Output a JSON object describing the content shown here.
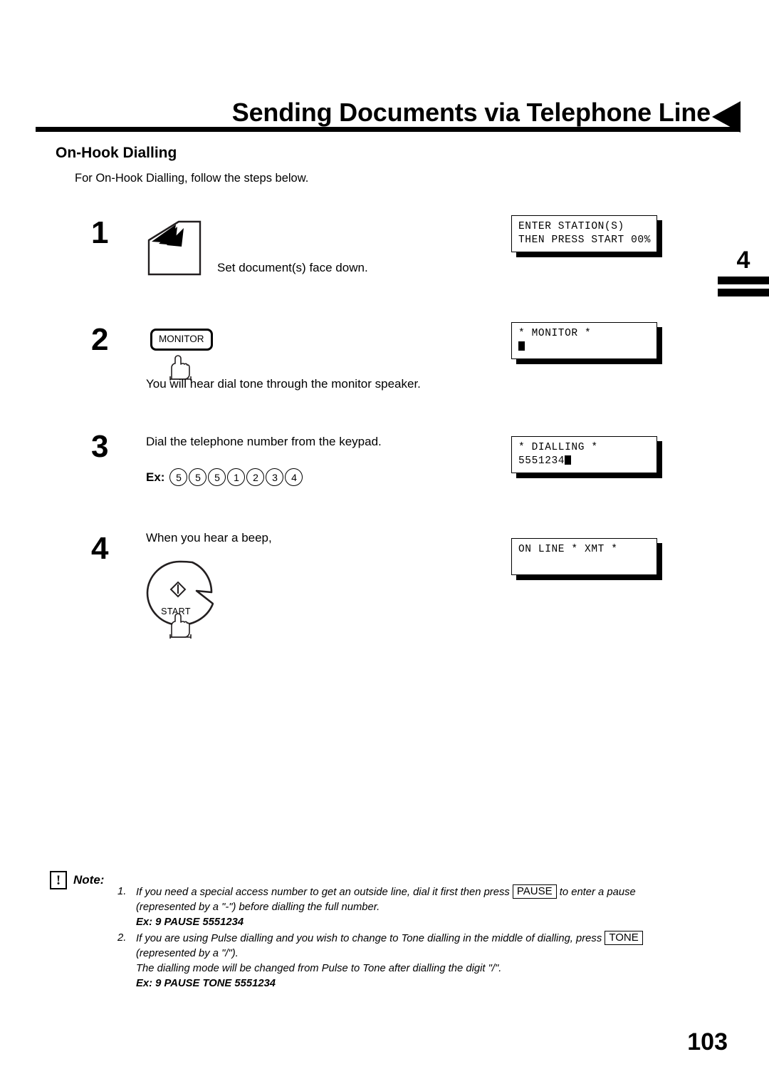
{
  "header": {
    "title": "Sending Documents via Telephone Line",
    "arrow_icon": "left-triangle-icon"
  },
  "chapter_tab": {
    "number": "4"
  },
  "section": {
    "title": "On-Hook Dialling",
    "intro": "For On-Hook Dialling, follow the steps below."
  },
  "steps": [
    {
      "number": "1",
      "icon": "document-feeder-icon",
      "text": "Set document(s) face down.",
      "lcd": {
        "line1": "ENTER STATION(S)",
        "line2": "THEN PRESS START 00%"
      }
    },
    {
      "number": "2",
      "key_label": "MONITOR",
      "icon": "pointing-finger-icon",
      "text": "You will hear dial tone through the monitor speaker.",
      "lcd": {
        "line1": "* MONITOR *",
        "line2": ""
      }
    },
    {
      "number": "3",
      "text": "Dial the telephone number from the keypad.",
      "example_label": "Ex:",
      "example_digits": [
        "5",
        "5",
        "5",
        "1",
        "2",
        "3",
        "4"
      ],
      "lcd": {
        "line1": "* DIALLING *",
        "line2": "5551234"
      }
    },
    {
      "number": "4",
      "text": "When you hear a beep,",
      "key_label": "START",
      "icon": "pointing-finger-icon",
      "lcd": {
        "line1": "ON LINE * XMT *",
        "line2": ""
      }
    }
  ],
  "note": {
    "icon": "exclamation-note-icon",
    "glyph": "!",
    "label": "Note:",
    "items": [
      {
        "marker": "1.",
        "text_before_key": "If you need a special access number to get an outside line, dial it first then press",
        "key": "PAUSE",
        "text_after_key": "to enter a pause",
        "line2": "(represented by a \"-\") before dialling the full number.",
        "example": "Ex: 9 PAUSE 5551234"
      },
      {
        "marker": "2.",
        "text_before_key": "If you are using Pulse dialling and you wish to change to Tone dialling in the middle of dialling, press",
        "key": "TONE",
        "text_after_key": "",
        "line2": "(represented by a \"/\").",
        "line3": "The dialling mode will be changed from Pulse to Tone after dialling the digit \"/\".",
        "example": "Ex: 9 PAUSE TONE 5551234"
      }
    ]
  },
  "page_number": "103"
}
